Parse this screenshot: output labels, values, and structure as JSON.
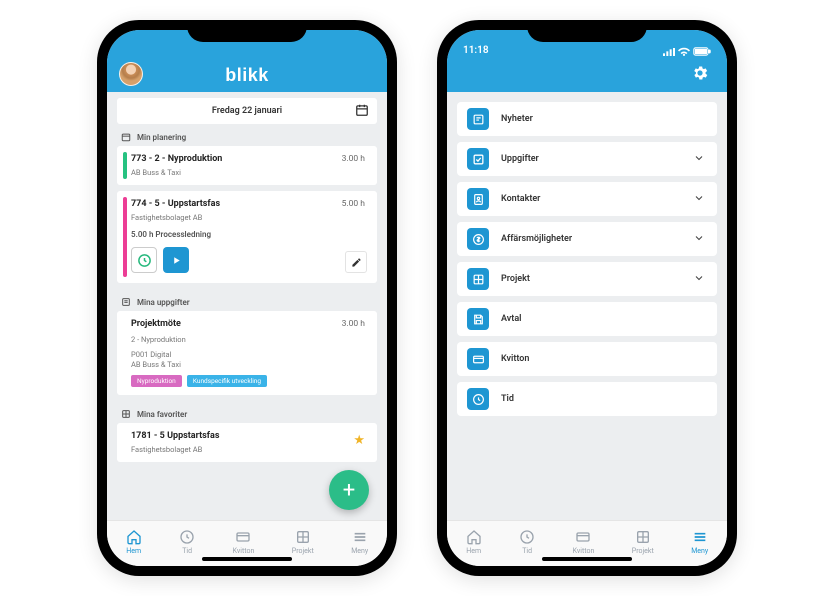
{
  "brand": "blikk",
  "phone1": {
    "date_label": "Fredag 22 januari",
    "sections": {
      "planning": "Min planering",
      "tasks": "Mina uppgifter",
      "favorites": "Mina favoriter"
    },
    "plan_items": [
      {
        "title": "773 - 2 - Nyproduktion",
        "sub": "AB Buss & Taxi",
        "hours": "3.00 h",
        "accent": "green"
      },
      {
        "title": "774 - 5 - Uppstartsfas",
        "sub": "Fastighetsbolaget AB",
        "hours": "5.00 h",
        "accent": "pink",
        "detail": "5.00 h Processledning"
      }
    ],
    "task_item": {
      "title": "Projektmöte",
      "hours": "3.00 h",
      "line1": "2 - Nyproduktion",
      "line2": "P001 Digital",
      "line3": "AB Buss & Taxi",
      "tags": [
        {
          "label": "Nyproduktion",
          "color": "pink"
        },
        {
          "label": "Kundspecifik utveckling",
          "color": "blue"
        }
      ]
    },
    "fav_item": {
      "title": "1781 - 5 Uppstartsfas",
      "sub": "Fastighetsbolaget AB"
    },
    "tabs": {
      "hem": "Hem",
      "tid": "Tid",
      "kvitton": "Kvitton",
      "projekt": "Projekt",
      "meny": "Meny"
    }
  },
  "phone2": {
    "time": "11:18",
    "menu": [
      {
        "label": "Nyheter",
        "icon": "news",
        "expandable": false
      },
      {
        "label": "Uppgifter",
        "icon": "check",
        "expandable": true
      },
      {
        "label": "Kontakter",
        "icon": "contacts",
        "expandable": true
      },
      {
        "label": "Affärsmöjligheter",
        "icon": "dollar",
        "expandable": true
      },
      {
        "label": "Projekt",
        "icon": "grid",
        "expandable": true
      },
      {
        "label": "Avtal",
        "icon": "save",
        "expandable": false
      },
      {
        "label": "Kvitton",
        "icon": "card",
        "expandable": false
      },
      {
        "label": "Tid",
        "icon": "clock",
        "expandable": false
      }
    ],
    "tabs": {
      "hem": "Hem",
      "tid": "Tid",
      "kvitton": "Kvitton",
      "projekt": "Projekt",
      "meny": "Meny"
    }
  },
  "colors": {
    "brand": "#29a3dc",
    "accent_green": "#26c281",
    "accent_pink": "#ec3d95"
  }
}
